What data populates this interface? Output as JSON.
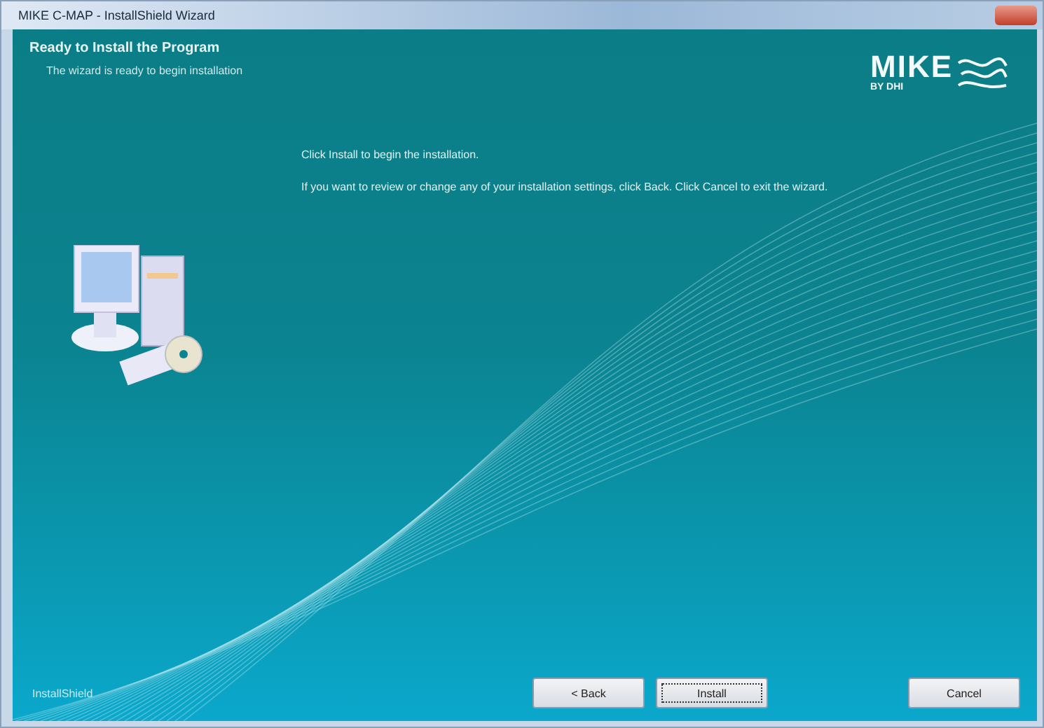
{
  "window": {
    "title": "MIKE C-MAP - InstallShield Wizard"
  },
  "header": {
    "title": "Ready to Install the Program",
    "subtitle": "The wizard is ready to begin installation",
    "logo": {
      "name": "MIKE",
      "tagline": "BY DHI"
    }
  },
  "body": {
    "paragraphs": [
      "Click Install to begin the installation.",
      "If you want to review or change any of your installation settings, click Back. Click Cancel to exit the wizard."
    ]
  },
  "footer": {
    "brand": "InstallShield",
    "buttons": [
      {
        "label": "< Back",
        "focused": false
      },
      {
        "label": "Install",
        "focused": true
      },
      {
        "label": "Cancel",
        "focused": false
      }
    ]
  }
}
